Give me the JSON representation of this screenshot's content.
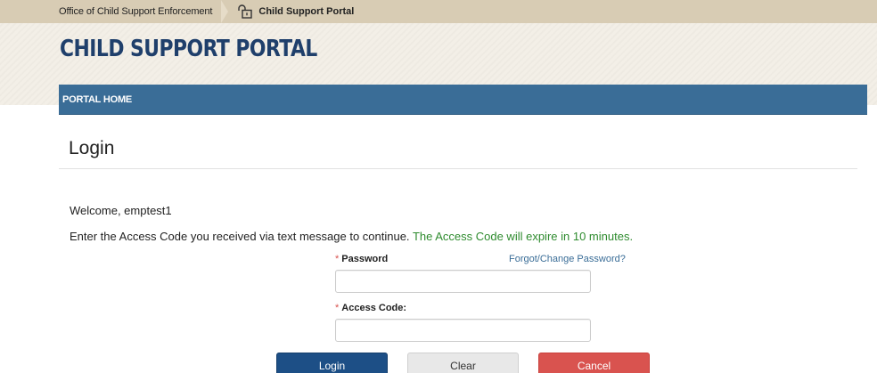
{
  "breadcrumb": {
    "parent": "Office of Child Support Enforcement",
    "current": "Child Support Portal",
    "current_icon": "lock-icon"
  },
  "header": {
    "title": "CHILD SUPPORT PORTAL"
  },
  "nav": {
    "items": [
      {
        "label": "PORTAL HOME"
      }
    ]
  },
  "main": {
    "heading": "Login",
    "welcome": "Welcome, emptest1",
    "instructions": "Enter the Access Code you received via text message to continue.",
    "expire_note": "The Access Code will expire in 10 minutes."
  },
  "form": {
    "required_marker": "*",
    "password_label": "Password",
    "password_value": "",
    "forgot_link": "Forgot/Change Password?",
    "access_code_label": "Access Code:",
    "access_code_value": ""
  },
  "buttons": {
    "login": "Login",
    "clear": "Clear",
    "cancel": "Cancel"
  },
  "colors": {
    "nav_bar": "#3a6d97",
    "title": "#1f3f6b",
    "login_button": "#1d4f86",
    "cancel_button": "#d9534f",
    "expire_note": "#2e8b2e",
    "required_marker": "#d9534f"
  }
}
